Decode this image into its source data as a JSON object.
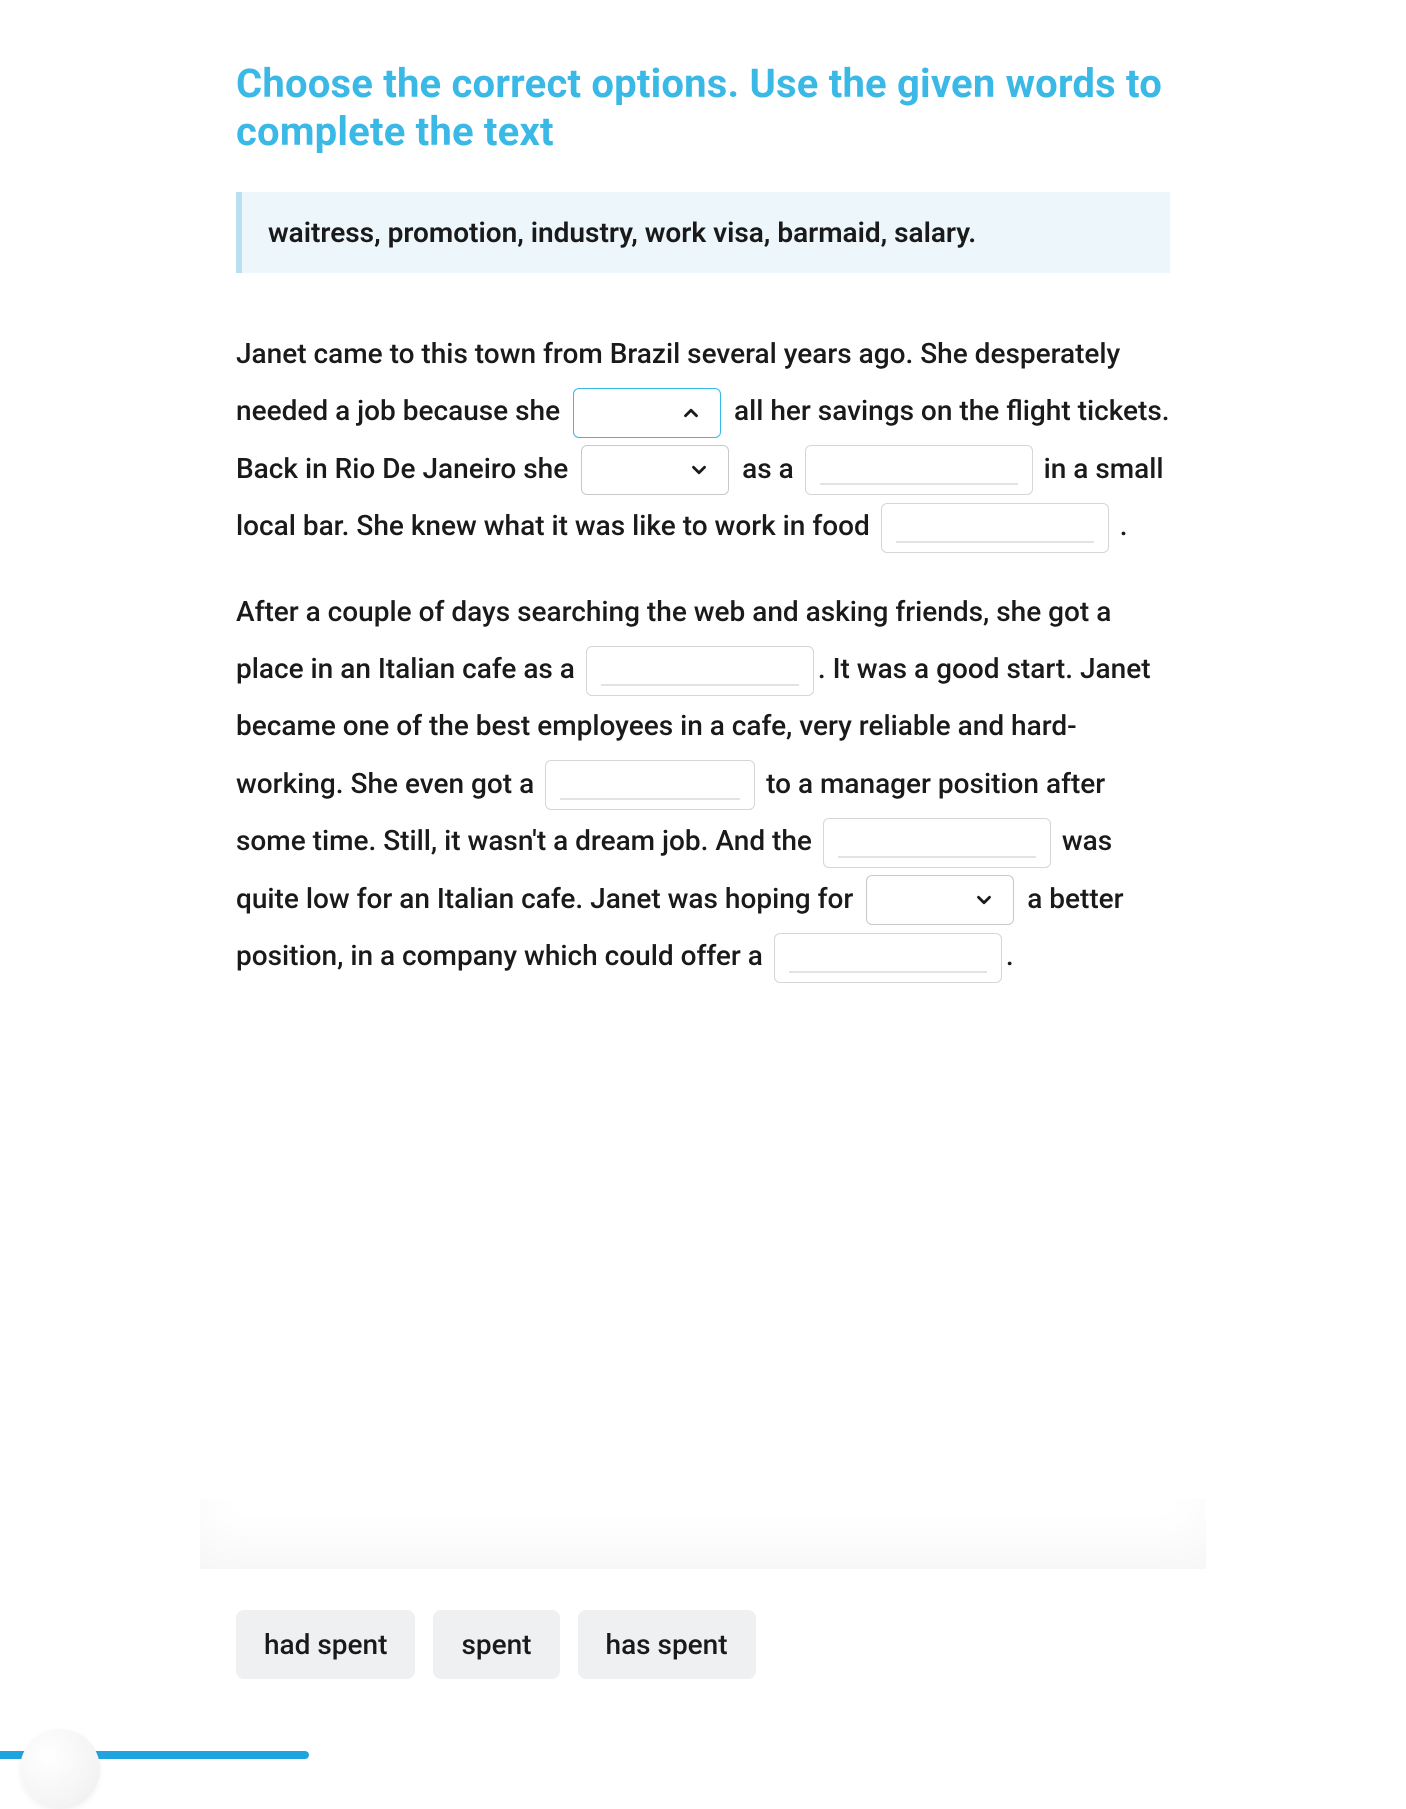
{
  "title": "Choose the correct options. Use the given words to complete the text",
  "wordbank": "waitress, promotion, industry, work visa, barmaid, salary.",
  "text": {
    "p1a": "Janet came to this town from Brazil several years ago. She desperately needed a job because she ",
    "p1b": " all her savings on the flight tickets.",
    "p2a": "Back in Rio De Janeiro she ",
    "p2b": " as a ",
    "p2c": " in a small local bar. She knew what it was like to work in food ",
    "p2d": " .",
    "p3a": "After a couple of days searching the web and asking friends, she got a place in an Italian cafe as a ",
    "p3b": ". It was a good start. Janet became one of the best employees in a cafe, very reliable and hard-working. She even got a ",
    "p3c": " to a manager position after some time. Still, it wasn't a dream job. And the ",
    "p3d": " was quite low for an Italian cafe. Janet was hoping for ",
    "p3e": " a better position, in a company which could offer a ",
    "p3f": "."
  },
  "options": {
    "active_dropdown_choices": [
      "had spent",
      "spent",
      "has spent"
    ]
  },
  "progress_percent": 22
}
